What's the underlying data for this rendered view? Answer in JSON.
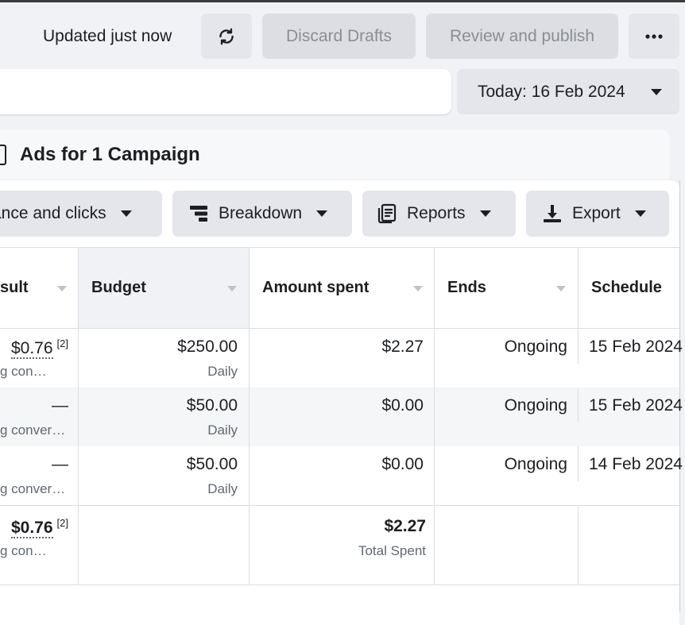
{
  "toolbar": {
    "status": "Updated just now",
    "refresh_icon": "refresh-icon",
    "discard_label": "Discard Drafts",
    "review_label": "Review and publish",
    "more_icon": "more-icon"
  },
  "filters": {
    "date_label": "Today: 16 Feb 2024"
  },
  "card": {
    "title": "Ads for 1 Campaign",
    "columns_preset": "ance and clicks",
    "breakdown_label": "Breakdown",
    "reports_label": "Reports",
    "export_label": "Export"
  },
  "table": {
    "headers": {
      "result": "sult",
      "budget": "Budget",
      "amount": "Amount spent",
      "ends": "Ends",
      "schedule": "Schedule"
    },
    "rows": [
      {
        "result": "$0.76",
        "result_note": "[2]",
        "result_sub": "g con…",
        "budget": "$250.00",
        "budget_sub": "Daily",
        "amount": "$2.27",
        "ends": "Ongoing",
        "schedule": "15 Feb 2024"
      },
      {
        "result": "—",
        "result_sub": "g conver…",
        "budget": "$50.00",
        "budget_sub": "Daily",
        "amount": "$0.00",
        "ends": "Ongoing",
        "schedule": "15 Feb 2024"
      },
      {
        "result": "—",
        "result_sub": "g conver…",
        "budget": "$50.00",
        "budget_sub": "Daily",
        "amount": "$0.00",
        "ends": "Ongoing",
        "schedule": "14 Feb 2024"
      }
    ],
    "total": {
      "result": "$0.76",
      "result_note": "[2]",
      "result_sub": "g con…",
      "amount": "$2.27",
      "amount_sub": "Total Spent"
    }
  },
  "colors": {
    "background": "#f0f2f5",
    "button": "#e4e6eb",
    "disabled_text": "#8a8d91",
    "highlight_row": "#f5f6f7"
  }
}
